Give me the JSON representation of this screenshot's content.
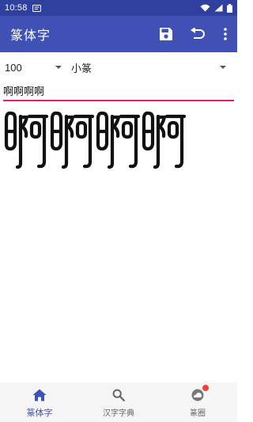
{
  "status_bar": {
    "time": "10:58",
    "icons": [
      "notification-icon",
      "wifi-icon",
      "signal-icon",
      "battery-icon"
    ]
  },
  "app_bar": {
    "title": "篆体字",
    "actions": [
      "save-icon",
      "undo-icon",
      "more-vert-icon"
    ]
  },
  "controls": {
    "size_value": "100",
    "font_value": "小篆"
  },
  "input": {
    "value": "啊啊啊啊"
  },
  "preview": {
    "text": "啊啊啊啊"
  },
  "bottom_nav": {
    "items": [
      {
        "label": "篆体字",
        "icon": "home-icon",
        "active": true
      },
      {
        "label": "汉字字典",
        "icon": "search-icon",
        "active": false
      },
      {
        "label": "篆圈",
        "icon": "cloud-icon",
        "active": false,
        "badge": true
      }
    ]
  },
  "colors": {
    "primary": "#3f51b5",
    "primary_dark": "#2f409f",
    "accent": "#e91e63",
    "badge": "#f44336",
    "nav_background": "#f5f5f5"
  }
}
